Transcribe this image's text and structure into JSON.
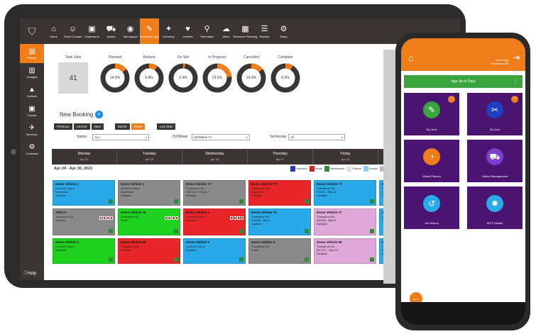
{
  "top_nav": {
    "items": [
      {
        "icon": "home-icon",
        "glyph": "⌂",
        "label": "Home"
      },
      {
        "icon": "driver-contact-icon",
        "glyph": "☺",
        "label": "Driver Contact"
      },
      {
        "icon": "inspection-icon",
        "glyph": "▣",
        "label": "Inspections"
      },
      {
        "icon": "assets-icon",
        "glyph": "⛟",
        "label": "Assets"
      },
      {
        "icon": "tachograph-icon",
        "glyph": "◉",
        "label": "Tachograph"
      },
      {
        "icon": "workshop-icon",
        "glyph": "✎",
        "label": "Workshop Jobs"
      },
      {
        "icon": "inventory-icon",
        "glyph": "✦",
        "label": "Inventory"
      },
      {
        "icon": "incident-icon",
        "glyph": "♥",
        "label": "Incident"
      },
      {
        "icon": "telematics-icon",
        "glyph": "⚲",
        "label": "Telematics"
      },
      {
        "icon": "alerts-icon",
        "glyph": "☁",
        "label": "Alerts"
      },
      {
        "icon": "resource-planning-icon",
        "glyph": "▦",
        "label": "Resource Planning"
      },
      {
        "icon": "reports-icon",
        "glyph": "☰",
        "label": "Reports"
      },
      {
        "icon": "setup-icon",
        "glyph": "⚙",
        "label": "Setup"
      }
    ]
  },
  "sidebar": {
    "items": [
      {
        "icon": "planner-icon",
        "glyph": "▤",
        "label": "Planner"
      },
      {
        "icon": "charges-icon",
        "glyph": "▥",
        "label": "Charges"
      },
      {
        "icon": "defects-icon",
        "glyph": "▲",
        "label": "Defects"
      },
      {
        "icon": "checks-icon",
        "glyph": "▣",
        "label": "Checks"
      },
      {
        "icon": "services-icon",
        "glyph": "✈",
        "label": "Services"
      },
      {
        "icon": "contracts-icon",
        "glyph": "⚙",
        "label": "Contracts"
      }
    ],
    "help_label": "Help"
  },
  "stats": {
    "total_label": "Total Jobs",
    "total_value": "41",
    "donuts": [
      {
        "label": "Planned",
        "value": "14.5%",
        "fraction": 0.145
      },
      {
        "label": "Booked",
        "value": "9.8%",
        "fraction": 0.098
      },
      {
        "label": "On Site",
        "value": "2.4%",
        "fraction": 0.024
      },
      {
        "label": "In Progress",
        "value": "23.5%",
        "fraction": 0.235
      },
      {
        "label": "Cancelled",
        "value": "14.3%",
        "fraction": 0.143
      },
      {
        "label": "Complete",
        "value": "8.9%",
        "fraction": 0.089
      }
    ]
  },
  "booking": {
    "title": "New Booking",
    "buttons": [
      "Previous",
      "Current",
      "Next"
    ],
    "view_buttons": [
      "Month",
      "Week"
    ],
    "list_view": "List View"
  },
  "filters": {
    "status_label": "Status",
    "status_value": "ALL",
    "isoweek_label": "ISOWeek",
    "isoweek_value": "ISOWeek 17",
    "technician_label": "Technician",
    "technician_value": "All"
  },
  "calendar": {
    "days": [
      {
        "day": "Monday",
        "date": "Apr 24"
      },
      {
        "day": "Tuesday",
        "date": "Apr 25"
      },
      {
        "day": "Wednesday",
        "date": "Apr 26"
      },
      {
        "day": "Thursday",
        "date": "Apr 27"
      },
      {
        "day": "Friday",
        "date": "Apr 28"
      },
      {
        "day": "Sa",
        "date": "Ap"
      }
    ],
    "range": "Apr 24 - Apr 30, 2023",
    "legend": [
      {
        "label": "Inspection",
        "color": "#1e3fbf"
      },
      {
        "label": "Repair",
        "color": "#c62828"
      },
      {
        "label": "Maintenance",
        "color": "#2e8b3a"
      },
      {
        "label": "Planned",
        "color": "#e0e0e0"
      },
      {
        "label": "Booked",
        "color": "#90caf9"
      },
      {
        "label": "On",
        "color": "#bdbdbd"
      }
    ],
    "cards": [
      {
        "title": "Demo Vehicle 1",
        "l1": "Limerick Depot",
        "l2": "Inspection",
        "l3": "Swallow",
        "color": "#29a9e8"
      },
      {
        "title": "Demo Vehicle 3",
        "l1": "Limerick Depot",
        "l2": "Inspection",
        "l3": "Swallow",
        "color": "#8a8a8a"
      },
      {
        "title": "Demo Vehicle 77",
        "l1": "Transaura HQ",
        "l2": "WALK14 - Repo 1",
        "l3": "Swallow",
        "color": "#8a8a8a"
      },
      {
        "title": "Demo Vehicle 77",
        "l1": "Transaura HQ",
        "l2": "Inspection",
        "l3": "Swallow",
        "color": "#e8262a"
      },
      {
        "title": "Demo Vehicle 77",
        "l1": "Transaura HQ",
        "l2": "FDB21 - Bay 11",
        "l3": "Swallow",
        "color": "#29a9e8"
      },
      {
        "title": "Demo Vehicle",
        "l1": "Transaura HQ",
        "l2": "DDE26 - Bay 8",
        "l3": "Swallow",
        "color": "#29a9e8"
      },
      {
        "title": "TRUCK",
        "l1": "Transaura HQ",
        "l2": "Anthony",
        "l3": "",
        "color": "#8a8a8a"
      },
      {
        "title": "Demo Vehicle 10",
        "l1": "Transaura HQ",
        "l2": "Share",
        "l3": "",
        "color": "#1fd11f"
      },
      {
        "title": "Demo Vehicle 1",
        "l1": "Limerick Depot",
        "l2": "Swallow",
        "l3": "",
        "color": "#e8262a"
      },
      {
        "title": "Demo Vehicle 75",
        "l1": "Transaura HQ",
        "l2": "DDE26 - Bay 8",
        "l3": "Swallow",
        "color": "#29a9e8"
      },
      {
        "title": "Demo Vehicle 77",
        "l1": "Transaura HQ",
        "l2": "DDE26 - Bay 8",
        "l3": "Swallow",
        "color": "#e0a8d8"
      },
      {
        "title": "Demo Vehicle",
        "l1": "Limerick Depot",
        "l2": "Swallow",
        "l3": "",
        "color": "#29a9e8"
      },
      {
        "title": "Demo Vehicle 5",
        "l1": "Limerick Depot",
        "l2": "Swallow",
        "l3": "",
        "color": "#1fd11f"
      },
      {
        "title": "Demo Vehicle 55",
        "l1": "Transaura HQ",
        "l2": "Swallow",
        "l3": "",
        "color": "#e8262a"
      },
      {
        "title": "Demo Vehicle 5",
        "l1": "Limerick Depot",
        "l2": "Swallow",
        "l3": "",
        "color": "#29a9e8"
      },
      {
        "title": "Demo Vehicle 5",
        "l1": "Transaura HQ",
        "l2": "Share",
        "l3": "",
        "color": "#8a8a8a"
      },
      {
        "title": "Demo Vehicle 55",
        "l1": "Transaura HQ",
        "l2": "MCC21 - Bay 12",
        "l3": "Swallow",
        "color": "#e0a8d8"
      },
      {
        "title": "Demo Vehicle",
        "l1": "Transaura HQ",
        "l2": "DDE11 - Bay",
        "l3": "Swallow",
        "color": "#29a9e8"
      }
    ]
  },
  "phone": {
    "user_line1": "Jane King",
    "user_line2": "Transaura HQ",
    "banner": "App Up to Date",
    "tiles": [
      {
        "label": "My Jobs",
        "icon": "wrench-icon",
        "glyph": "✎",
        "circle": "#3aa53c",
        "has_badge": true
      },
      {
        "label": "All Jobs",
        "icon": "tools-icon",
        "glyph": "✂",
        "circle": "#1e3fbf",
        "has_badge": true
      },
      {
        "label": "Wheel Fitment",
        "icon": "pie-icon",
        "glyph": "◔",
        "circle": "#ef7d1a",
        "has_badge": false
      },
      {
        "label": "Defect Management",
        "icon": "truck-icon",
        "glyph": "⛟",
        "circle": "#7b3fd0",
        "has_badge": false
      },
      {
        "label": "Job History",
        "icon": "history-icon",
        "glyph": "↺",
        "circle": "#29a9e8",
        "has_badge": false
      },
      {
        "label": "MOT Details",
        "icon": "gear-icon",
        "glyph": "✹",
        "circle": "#29a9e8",
        "has_badge": false
      }
    ]
  }
}
